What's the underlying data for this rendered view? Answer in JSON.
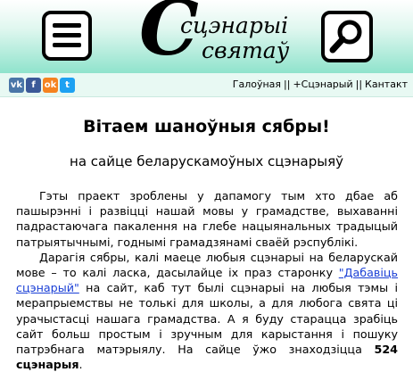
{
  "header": {
    "logo_letter": "С",
    "logo_line1": "сцэнарыі",
    "logo_line2": "святаў"
  },
  "social": {
    "vk": "vk",
    "facebook": "f",
    "odnoklassniki": "ok",
    "twitter": "t"
  },
  "nav": {
    "home": "Галоўная",
    "add": "+Сцэнарый",
    "contact": "Кантакт",
    "separator": "||"
  },
  "main": {
    "title": "Вітаем шаноўныя сябры!",
    "subtitle": "на сайце беларускамоўных сцэнарыяў",
    "p1": "Гэты праект зроблены у дапамогу тым хто дбае аб пашырэнні і развіцці нашай мовы у грамадстве, выхаванні падрастаючага пакалення на глебе нацыянальных традыцый патрыятычнымі, годнымі грамадзянамі сваёй рэспублікі.",
    "p2_before": "Дарагія сябры, калі маеце любыя сцэнарыі на беларускай мове – то калі ласка, дасылайце іх праз старонку ",
    "p2_link": "\"Дабавіць сцэнарый\"",
    "p2_after": " на сайт, каб тут былі сцэнарыі на любыя тэмы і мерапрыемствы не толькі для школы, а для любога свята ці урачыстасці нашага грамадства. А я буду старацца зрабіць сайт больш простым і зручным для карыстання і пошуку патрэбнага матэрыялу. На сайце ўжо знаходзіцца ",
    "count": "524",
    "count_unit": "сцэнарыя",
    "p2_end": "."
  },
  "colors": {
    "header_bottom": "#8fe3cc",
    "vk": "#4a76a8",
    "facebook": "#3b5998",
    "odnoklassniki": "#f58220",
    "twitter": "#1da1f2",
    "link": "#1a3fd6"
  }
}
